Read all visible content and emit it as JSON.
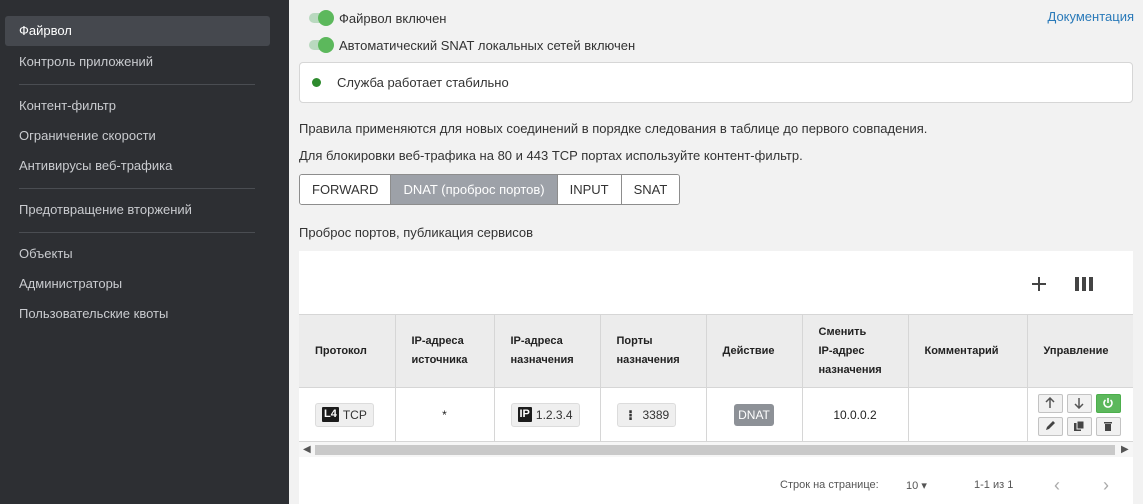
{
  "sidebar": {
    "active": "Файрвол",
    "items": [
      "Контроль приложений",
      "Контент-фильтр",
      "Ограничение скорости",
      "Антивирусы веб-трафика",
      "Предотвращение вторжений",
      "Объекты",
      "Администраторы",
      "Пользовательские квоты"
    ]
  },
  "header": {
    "toggle_firewall": "Файрвол включен",
    "toggle_snat": "Автоматический SNAT локальных сетей включен",
    "doc_link": "Документация"
  },
  "status": {
    "text": "Служба работает стабильно",
    "color": "#2e8b2e"
  },
  "info": {
    "line1": "Правила применяются для новых соединений в порядке следования в таблице до первого совпадения.",
    "line2": "Для блокировки веб-трафика на 80 и 443 TCP портах используйте контент-фильтр."
  },
  "tabs": [
    "FORWARD",
    "DNAT (проброс портов)",
    "INPUT",
    "SNAT"
  ],
  "active_tab": "DNAT (проброс портов)",
  "section_title": "Проброс портов, публикация сервисов",
  "toolbar": {
    "add_icon": "plus-icon",
    "columns_icon": "columns-icon"
  },
  "table": {
    "headers": {
      "protocol": "Протокол",
      "src1": "IP-адреса",
      "src2": "источника",
      "dst1": "IP-адреса",
      "dst2": "назначения",
      "ports1": "Порты",
      "ports2": "назначения",
      "action": "Действие",
      "change1": "Сменить",
      "change2": "IP-адрес",
      "change3": "назначения",
      "comment": "Комментарий",
      "manage": "Управление"
    },
    "row": {
      "protocol_tag": "L4",
      "protocol": "TCP",
      "source": "*",
      "dest_tag": "IP",
      "dest": "1.2.3.4",
      "port_tag": "⁝",
      "port": "3389",
      "action": "DNAT",
      "new_ip": "10.0.0.2",
      "comment": ""
    }
  },
  "pager": {
    "rows_label": "Строк на странице:",
    "rows_value": "10",
    "range": "1-1 из 1"
  }
}
